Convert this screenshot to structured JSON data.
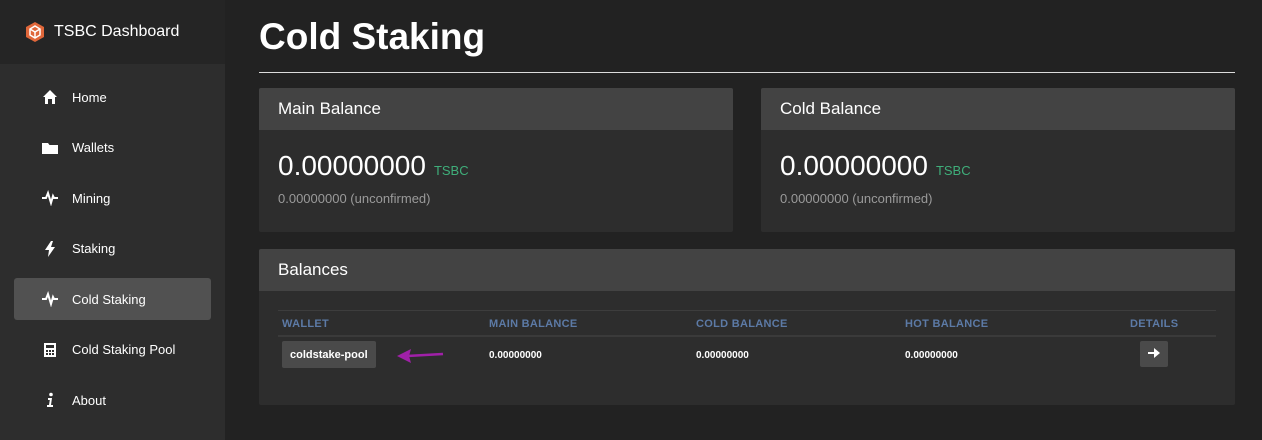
{
  "app": {
    "brand": "TSBC Dashboard"
  },
  "sidebar": {
    "items": [
      {
        "label": "Home",
        "icon": "home-icon"
      },
      {
        "label": "Wallets",
        "icon": "folder-icon"
      },
      {
        "label": "Mining",
        "icon": "pulse-icon"
      },
      {
        "label": "Staking",
        "icon": "bolt-icon"
      },
      {
        "label": "Cold Staking",
        "icon": "pulse-icon",
        "active": true
      },
      {
        "label": "Cold Staking Pool",
        "icon": "calculator-icon"
      },
      {
        "label": "About",
        "icon": "info-icon"
      }
    ]
  },
  "page": {
    "title": "Cold Staking"
  },
  "main_balance": {
    "title": "Main Balance",
    "amount": "0.00000000",
    "unit": "TSBC",
    "unconfirmed": "0.00000000 (unconfirmed)"
  },
  "cold_balance": {
    "title": "Cold Balance",
    "amount": "0.00000000",
    "unit": "TSBC",
    "unconfirmed": "0.00000000 (unconfirmed)"
  },
  "balances": {
    "title": "Balances",
    "columns": [
      "WALLET",
      "MAIN BALANCE",
      "COLD BALANCE",
      "HOT BALANCE",
      "DETAILS"
    ],
    "rows": [
      {
        "wallet": "coldstake-pool",
        "main": "0.00000000",
        "cold": "0.00000000",
        "hot": "0.00000000"
      }
    ]
  },
  "colors": {
    "accent_unit": "#3fae7a",
    "header_text": "#5c7aa6",
    "annotation_arrow": "#a020a8"
  }
}
